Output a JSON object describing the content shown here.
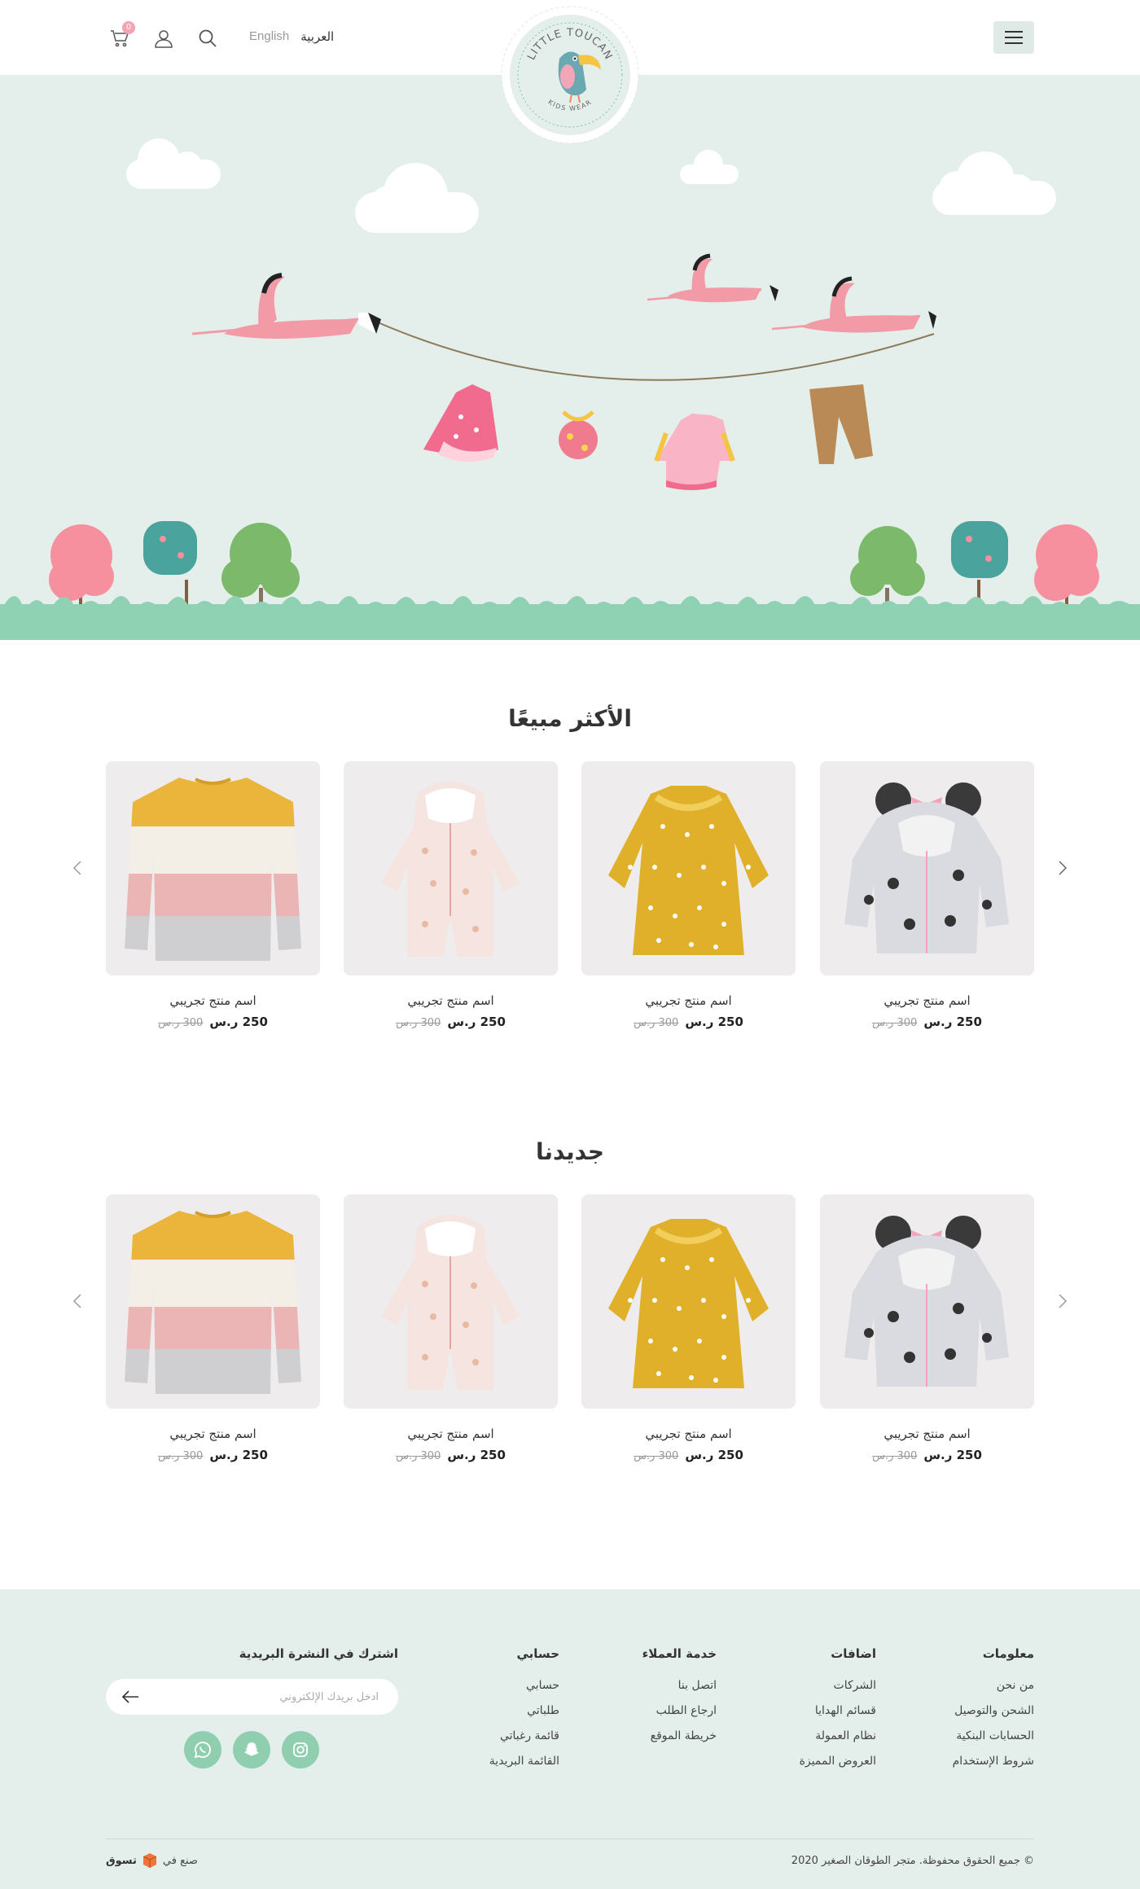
{
  "header": {
    "cart_count": "0",
    "lang_en": "English",
    "lang_ar": "العربية",
    "logo_top": "LITTLE TOUCAN",
    "logo_bottom": "KIDS WEAR"
  },
  "bestsellers": {
    "title": "الأكثر مبيعًا",
    "products": [
      {
        "name": "اسم منتج تجريبي",
        "price": "250 ر.س",
        "old_price": "300 ر.س",
        "image": "minnie-jacket"
      },
      {
        "name": "اسم منتج تجريبي",
        "price": "250 ر.س",
        "old_price": "300 ر.س",
        "image": "yellow-dress"
      },
      {
        "name": "اسم منتج تجريبي",
        "price": "250 ر.س",
        "old_price": "300 ر.س",
        "image": "pink-romper"
      },
      {
        "name": "اسم منتج تجريبي",
        "price": "250 ر.س",
        "old_price": "300 ر.س",
        "image": "striped-sweater"
      }
    ]
  },
  "newarrivals": {
    "title": "جديدنا",
    "products": [
      {
        "name": "اسم منتج تجريبي",
        "price": "250 ر.س",
        "old_price": "300 ر.س",
        "image": "minnie-jacket"
      },
      {
        "name": "اسم منتج تجريبي",
        "price": "250 ر.س",
        "old_price": "300 ر.س",
        "image": "yellow-dress"
      },
      {
        "name": "اسم منتج تجريبي",
        "price": "250 ر.س",
        "old_price": "300 ر.س",
        "image": "pink-romper"
      },
      {
        "name": "اسم منتج تجريبي",
        "price": "250 ر.س",
        "old_price": "300 ر.س",
        "image": "striped-sweater"
      }
    ]
  },
  "footer": {
    "columns": [
      {
        "title": "معلومات",
        "links": [
          "من نحن",
          "الشحن والتوصيل",
          "الحسابات البنكية",
          "شروط الإستخدام"
        ]
      },
      {
        "title": "اضافات",
        "links": [
          "الشركات",
          "قسائم الهدايا",
          "نظام العمولة",
          "العروض المميزة"
        ]
      },
      {
        "title": "خدمة العملاء",
        "links": [
          "اتصل بنا",
          "ارجاع الطلب",
          "خريطة الموقع"
        ]
      },
      {
        "title": "حسابي",
        "links": [
          "حسابي",
          "طلباتي",
          "قائمة رغباتي",
          "القائمة البريدية"
        ]
      }
    ],
    "newsletter_title": "اشترك في النشرة البريدية",
    "newsletter_placeholder": "ادخل بريدك الإلكتروني",
    "copyright": "© جميع الحقوق محفوظة. متجر الطوقان الصغير 2020",
    "made_in": "صنع في",
    "made_brand": "تسوق"
  },
  "colors": {
    "accent_green": "#8fcfb0",
    "hero_bg": "#e4eeeb",
    "pink": "#f4a3b1"
  }
}
